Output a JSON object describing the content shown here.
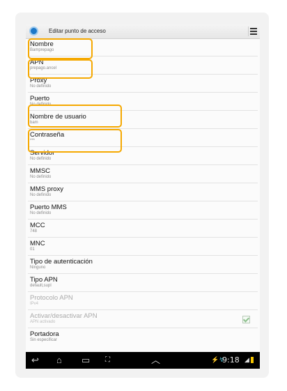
{
  "header": {
    "title": "Editar punto de acceso"
  },
  "items": [
    {
      "title": "Nombre",
      "summary": "Bamprepago"
    },
    {
      "title": "APN",
      "summary": "prepago.ancel"
    },
    {
      "title": "Proxy",
      "summary": "No definido"
    },
    {
      "title": "Puerto",
      "summary": "No definido"
    },
    {
      "title": "Nombre de usuario",
      "summary": "bam"
    },
    {
      "title": "Contraseña",
      "summary": "***"
    },
    {
      "title": "Servidor",
      "summary": "No definido"
    },
    {
      "title": "MMSC",
      "summary": "No definido"
    },
    {
      "title": "MMS proxy",
      "summary": "No definido"
    },
    {
      "title": "Puerto MMS",
      "summary": "No definido"
    },
    {
      "title": "MCC",
      "summary": "748"
    },
    {
      "title": "MNC",
      "summary": "01"
    },
    {
      "title": "Tipo de autenticación",
      "summary": "Ninguno"
    },
    {
      "title": "Tipo APN",
      "summary": "default,supl"
    },
    {
      "title": "Protocolo APN",
      "summary": "IPv4"
    },
    {
      "title": "Activar/desactivar APN",
      "summary": "APN activado"
    },
    {
      "title": "Portadora",
      "summary": "Sin especificar"
    }
  ],
  "status": {
    "time": "9:18"
  },
  "colors": {
    "highlight": "#f5a800",
    "navbar": "#000000"
  },
  "icons": [
    "settings-icon",
    "overflow-menu-icon",
    "back-icon",
    "home-icon",
    "recent-apps-icon",
    "screenshot-icon",
    "up-arrow-icon",
    "usb-icon",
    "battery-icon"
  ]
}
